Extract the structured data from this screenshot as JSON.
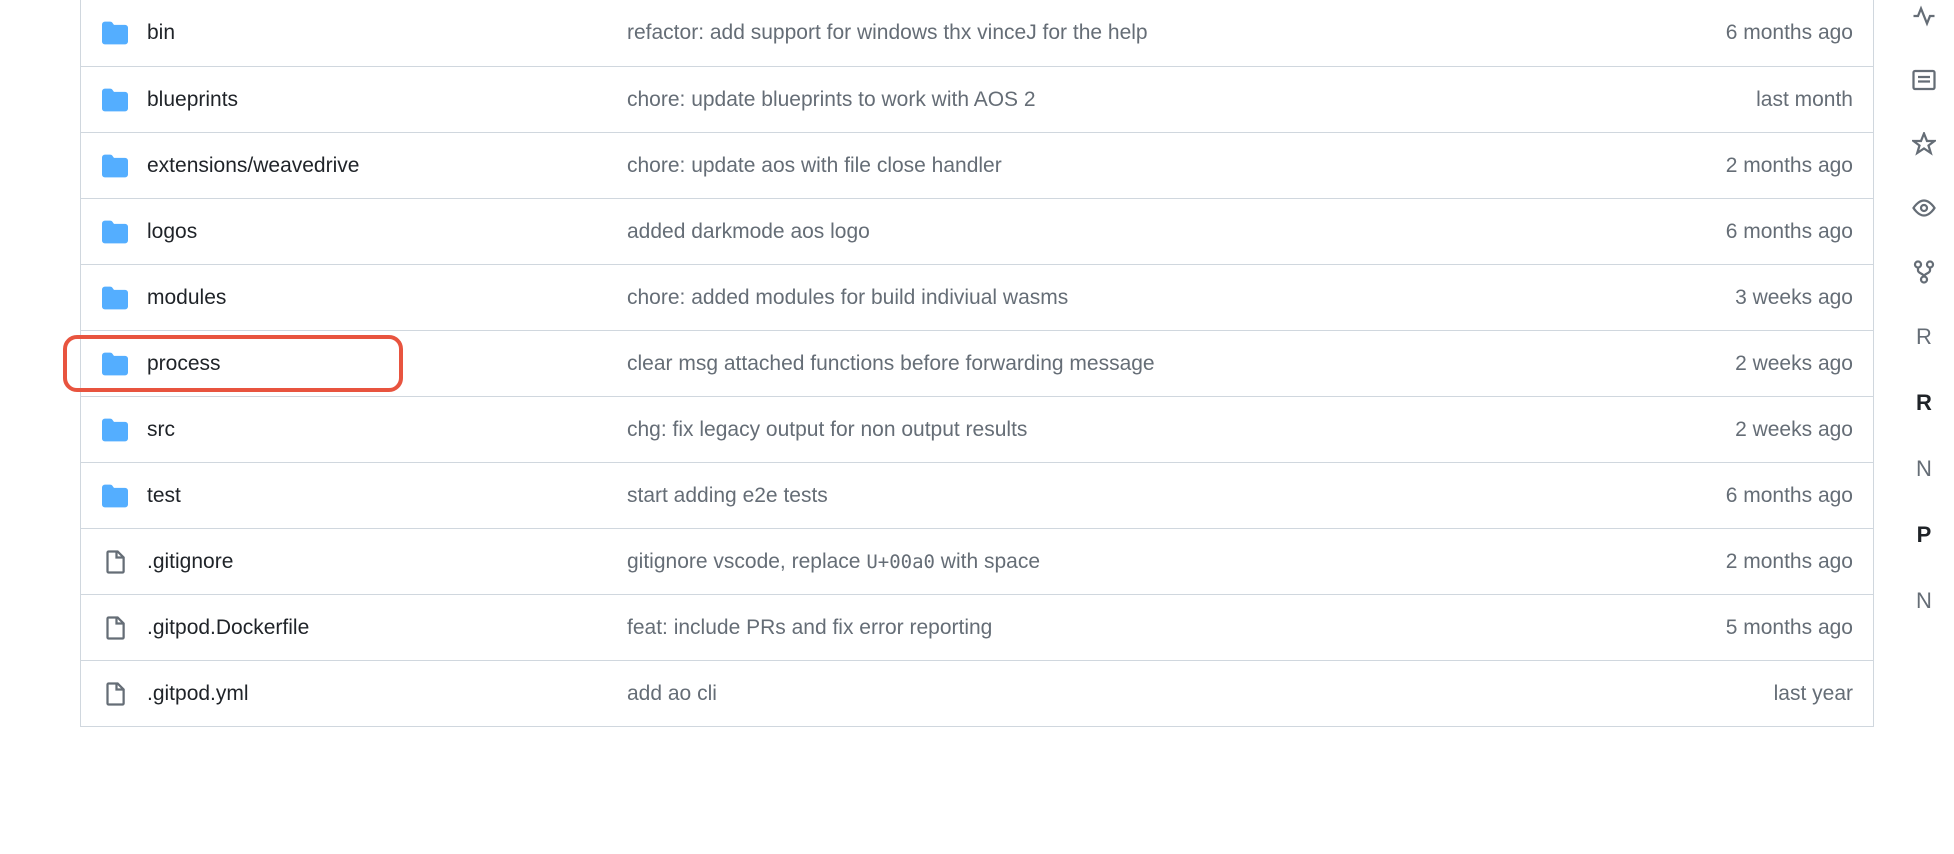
{
  "files": [
    {
      "type": "folder",
      "name": "bin",
      "commit": "refactor: add support for windows thx vinceJ for the help",
      "time": "6 months ago",
      "highlighted": false
    },
    {
      "type": "folder",
      "name": "blueprints",
      "commit": "chore: update blueprints to work with AOS 2",
      "time": "last month",
      "highlighted": false
    },
    {
      "type": "folder",
      "name": "extensions/weavedrive",
      "commit": "chore: update aos with file close handler",
      "time": "2 months ago",
      "highlighted": false
    },
    {
      "type": "folder",
      "name": "logos",
      "commit": "added darkmode aos logo",
      "time": "6 months ago",
      "highlighted": false
    },
    {
      "type": "folder",
      "name": "modules",
      "commit": "chore: added modules for build indiviual wasms",
      "time": "3 weeks ago",
      "highlighted": false
    },
    {
      "type": "folder",
      "name": "process",
      "commit": "clear msg attached functions before forwarding message",
      "time": "2 weeks ago",
      "highlighted": true
    },
    {
      "type": "folder",
      "name": "src",
      "commit": "chg: fix legacy output for non output results",
      "time": "2 weeks ago",
      "highlighted": false
    },
    {
      "type": "folder",
      "name": "test",
      "commit": "start adding e2e tests",
      "time": "6 months ago",
      "highlighted": false
    },
    {
      "type": "file",
      "name": ".gitignore",
      "commit_pre": "gitignore vscode, replace ",
      "commit_code": "U+00a0",
      "commit_post": " with space",
      "time": "2 months ago",
      "highlighted": false
    },
    {
      "type": "file",
      "name": ".gitpod.Dockerfile",
      "commit": "feat: include PRs and fix error reporting",
      "time": "5 months ago",
      "highlighted": false
    },
    {
      "type": "file",
      "name": ".gitpod.yml",
      "commit": "add ao cli",
      "time": "last year",
      "highlighted": false
    }
  ],
  "sidebar": {
    "items": [
      "R",
      "R",
      "N",
      "P",
      "N"
    ]
  }
}
